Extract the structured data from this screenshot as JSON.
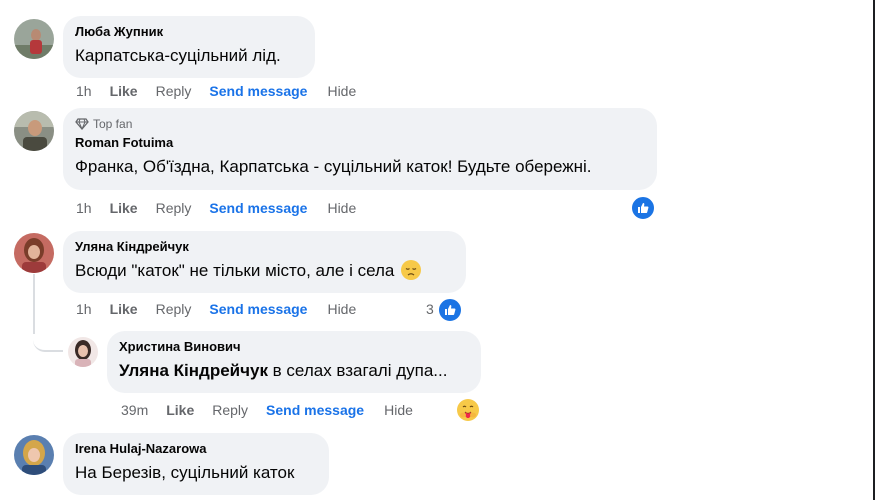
{
  "comments": [
    {
      "author": "Люба Жупник",
      "text": "Карпатська-суцільний лід.",
      "time": "1h",
      "like": "Like",
      "reply": "Reply",
      "send": "Send message",
      "hide": "Hide"
    },
    {
      "badge": "Top fan",
      "author": "Roman Fotuima",
      "text": "Франка, Об'їздна, Карпатська - суцільний каток! Будьте обережні.",
      "time": "1h",
      "like": "Like",
      "reply": "Reply",
      "send": "Send message",
      "hide": "Hide"
    },
    {
      "author": "Уляна Кіндрейчук",
      "text": "Всюди \"каток\" не тільки місто, але і села",
      "time": "1h",
      "like": "Like",
      "reply": "Reply",
      "send": "Send message",
      "hide": "Hide",
      "reaction_count": "3"
    },
    {
      "author": "Христина Винович",
      "mention": "Уляна Кіндрейчук",
      "text": " в селах взагалі дупа...",
      "time": "39m",
      "like": "Like",
      "reply": "Reply",
      "send": "Send message",
      "hide": "Hide"
    },
    {
      "author": "Irena Hulaj-Nazarowa",
      "text": "На Березів, суцільний каток"
    }
  ],
  "colors": {
    "bubble": "#f0f2f5",
    "link_blue": "#1a73e8",
    "like_blue": "#1b74e4",
    "meta_gray": "#65676b"
  },
  "icons": [
    "top-fan-diamond-icon",
    "like-reaction-icon",
    "sad-emoji-icon",
    "care-reaction-icon"
  ]
}
